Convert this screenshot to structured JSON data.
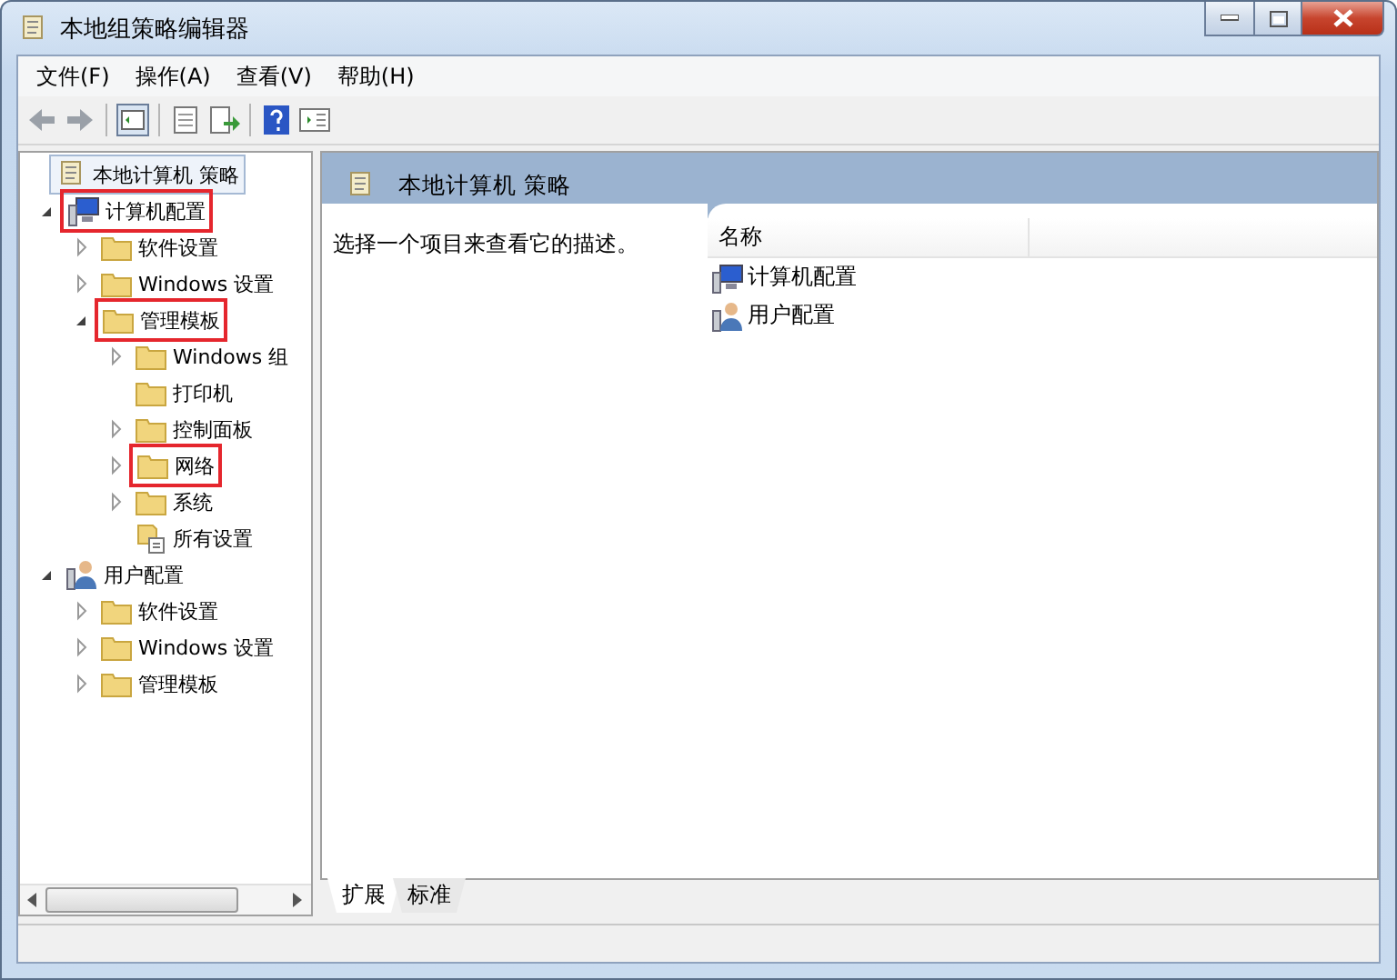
{
  "window": {
    "title": "本地组策略编辑器"
  },
  "menu": [
    "文件(F)",
    "操作(A)",
    "查看(V)",
    "帮助(H)"
  ],
  "tree": [
    {
      "label": "本地计算机 策略",
      "kind": "policy",
      "selected": true,
      "marked": false,
      "children": [
        {
          "label": "计算机配置",
          "kind": "computer",
          "selected": false,
          "marked": true,
          "expanded": true,
          "children": [
            {
              "label": "软件设置",
              "kind": "folder",
              "selected": false,
              "marked": false,
              "expanded": false
            },
            {
              "label": "Windows 设置",
              "kind": "folder",
              "selected": false,
              "marked": false,
              "expanded": false
            },
            {
              "label": "管理模板",
              "kind": "folder",
              "selected": false,
              "marked": true,
              "expanded": true,
              "children": [
                {
                  "label": "Windows 组",
                  "kind": "folder",
                  "selected": false,
                  "marked": false,
                  "expanded": false
                },
                {
                  "label": "打印机",
                  "kind": "folder",
                  "selected": false,
                  "marked": false
                },
                {
                  "label": "控制面板",
                  "kind": "folder",
                  "selected": false,
                  "marked": false,
                  "expanded": false
                },
                {
                  "label": "网络",
                  "kind": "folder",
                  "selected": false,
                  "marked": true,
                  "expanded": false
                },
                {
                  "label": "系统",
                  "kind": "folder",
                  "selected": false,
                  "marked": false,
                  "expanded": false
                },
                {
                  "label": "所有设置",
                  "kind": "settings",
                  "selected": false,
                  "marked": false
                }
              ]
            }
          ]
        },
        {
          "label": "用户配置",
          "kind": "user",
          "selected": false,
          "marked": false,
          "expanded": true,
          "children": [
            {
              "label": "软件设置",
              "kind": "folder",
              "selected": false,
              "marked": false,
              "expanded": false
            },
            {
              "label": "Windows 设置",
              "kind": "folder",
              "selected": false,
              "marked": false,
              "expanded": false
            },
            {
              "label": "管理模板",
              "kind": "folder",
              "selected": false,
              "marked": false,
              "expanded": false
            }
          ]
        }
      ]
    }
  ],
  "detail": {
    "title": "本地计算机 策略",
    "description": "选择一个项目来查看它的描述。",
    "column": "名称",
    "items": [
      {
        "label": "计算机配置",
        "kind": "computer"
      },
      {
        "label": "用户配置",
        "kind": "user"
      }
    ]
  },
  "tabs": [
    {
      "label": "扩展",
      "selected": true
    },
    {
      "label": "标准",
      "selected": false
    }
  ]
}
